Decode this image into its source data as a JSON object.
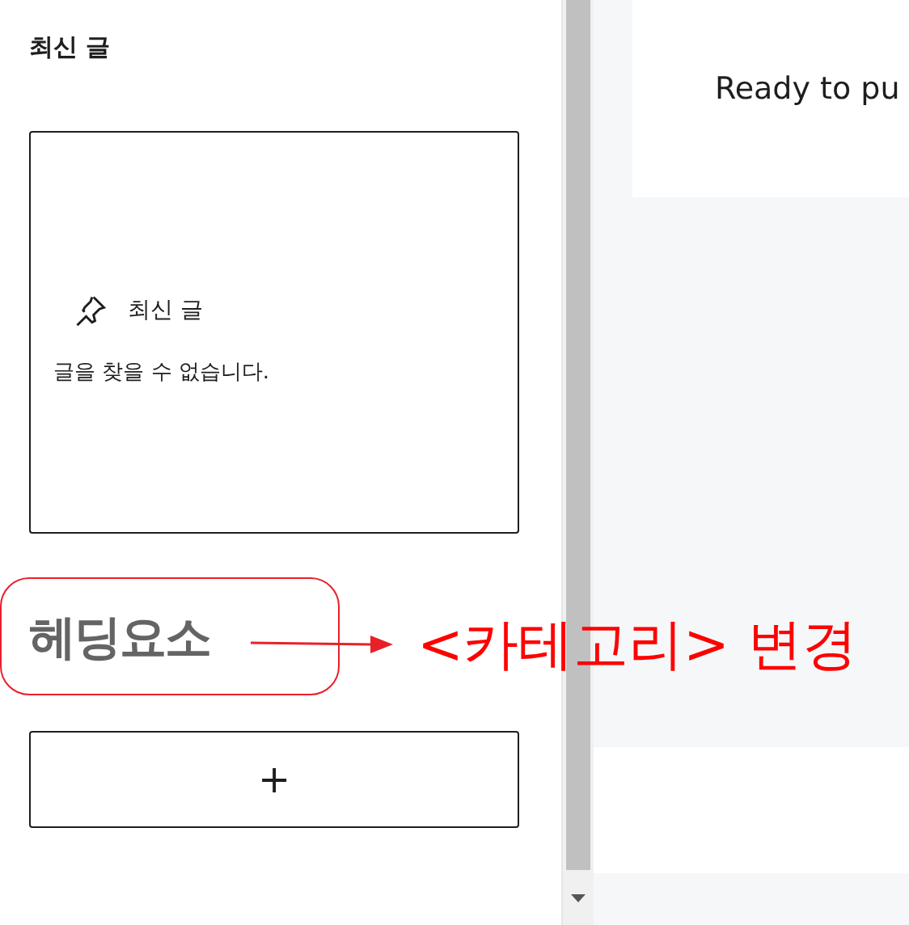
{
  "sidebar": {
    "title": "최신 글",
    "widget": {
      "title": "최신 글",
      "message": "글을 찾을 수 없습니다."
    },
    "heading": "헤딩요소",
    "add_button": "+"
  },
  "main": {
    "notice": "Ready to pu"
  },
  "annotation": {
    "text": "<카테고리> 변경"
  }
}
